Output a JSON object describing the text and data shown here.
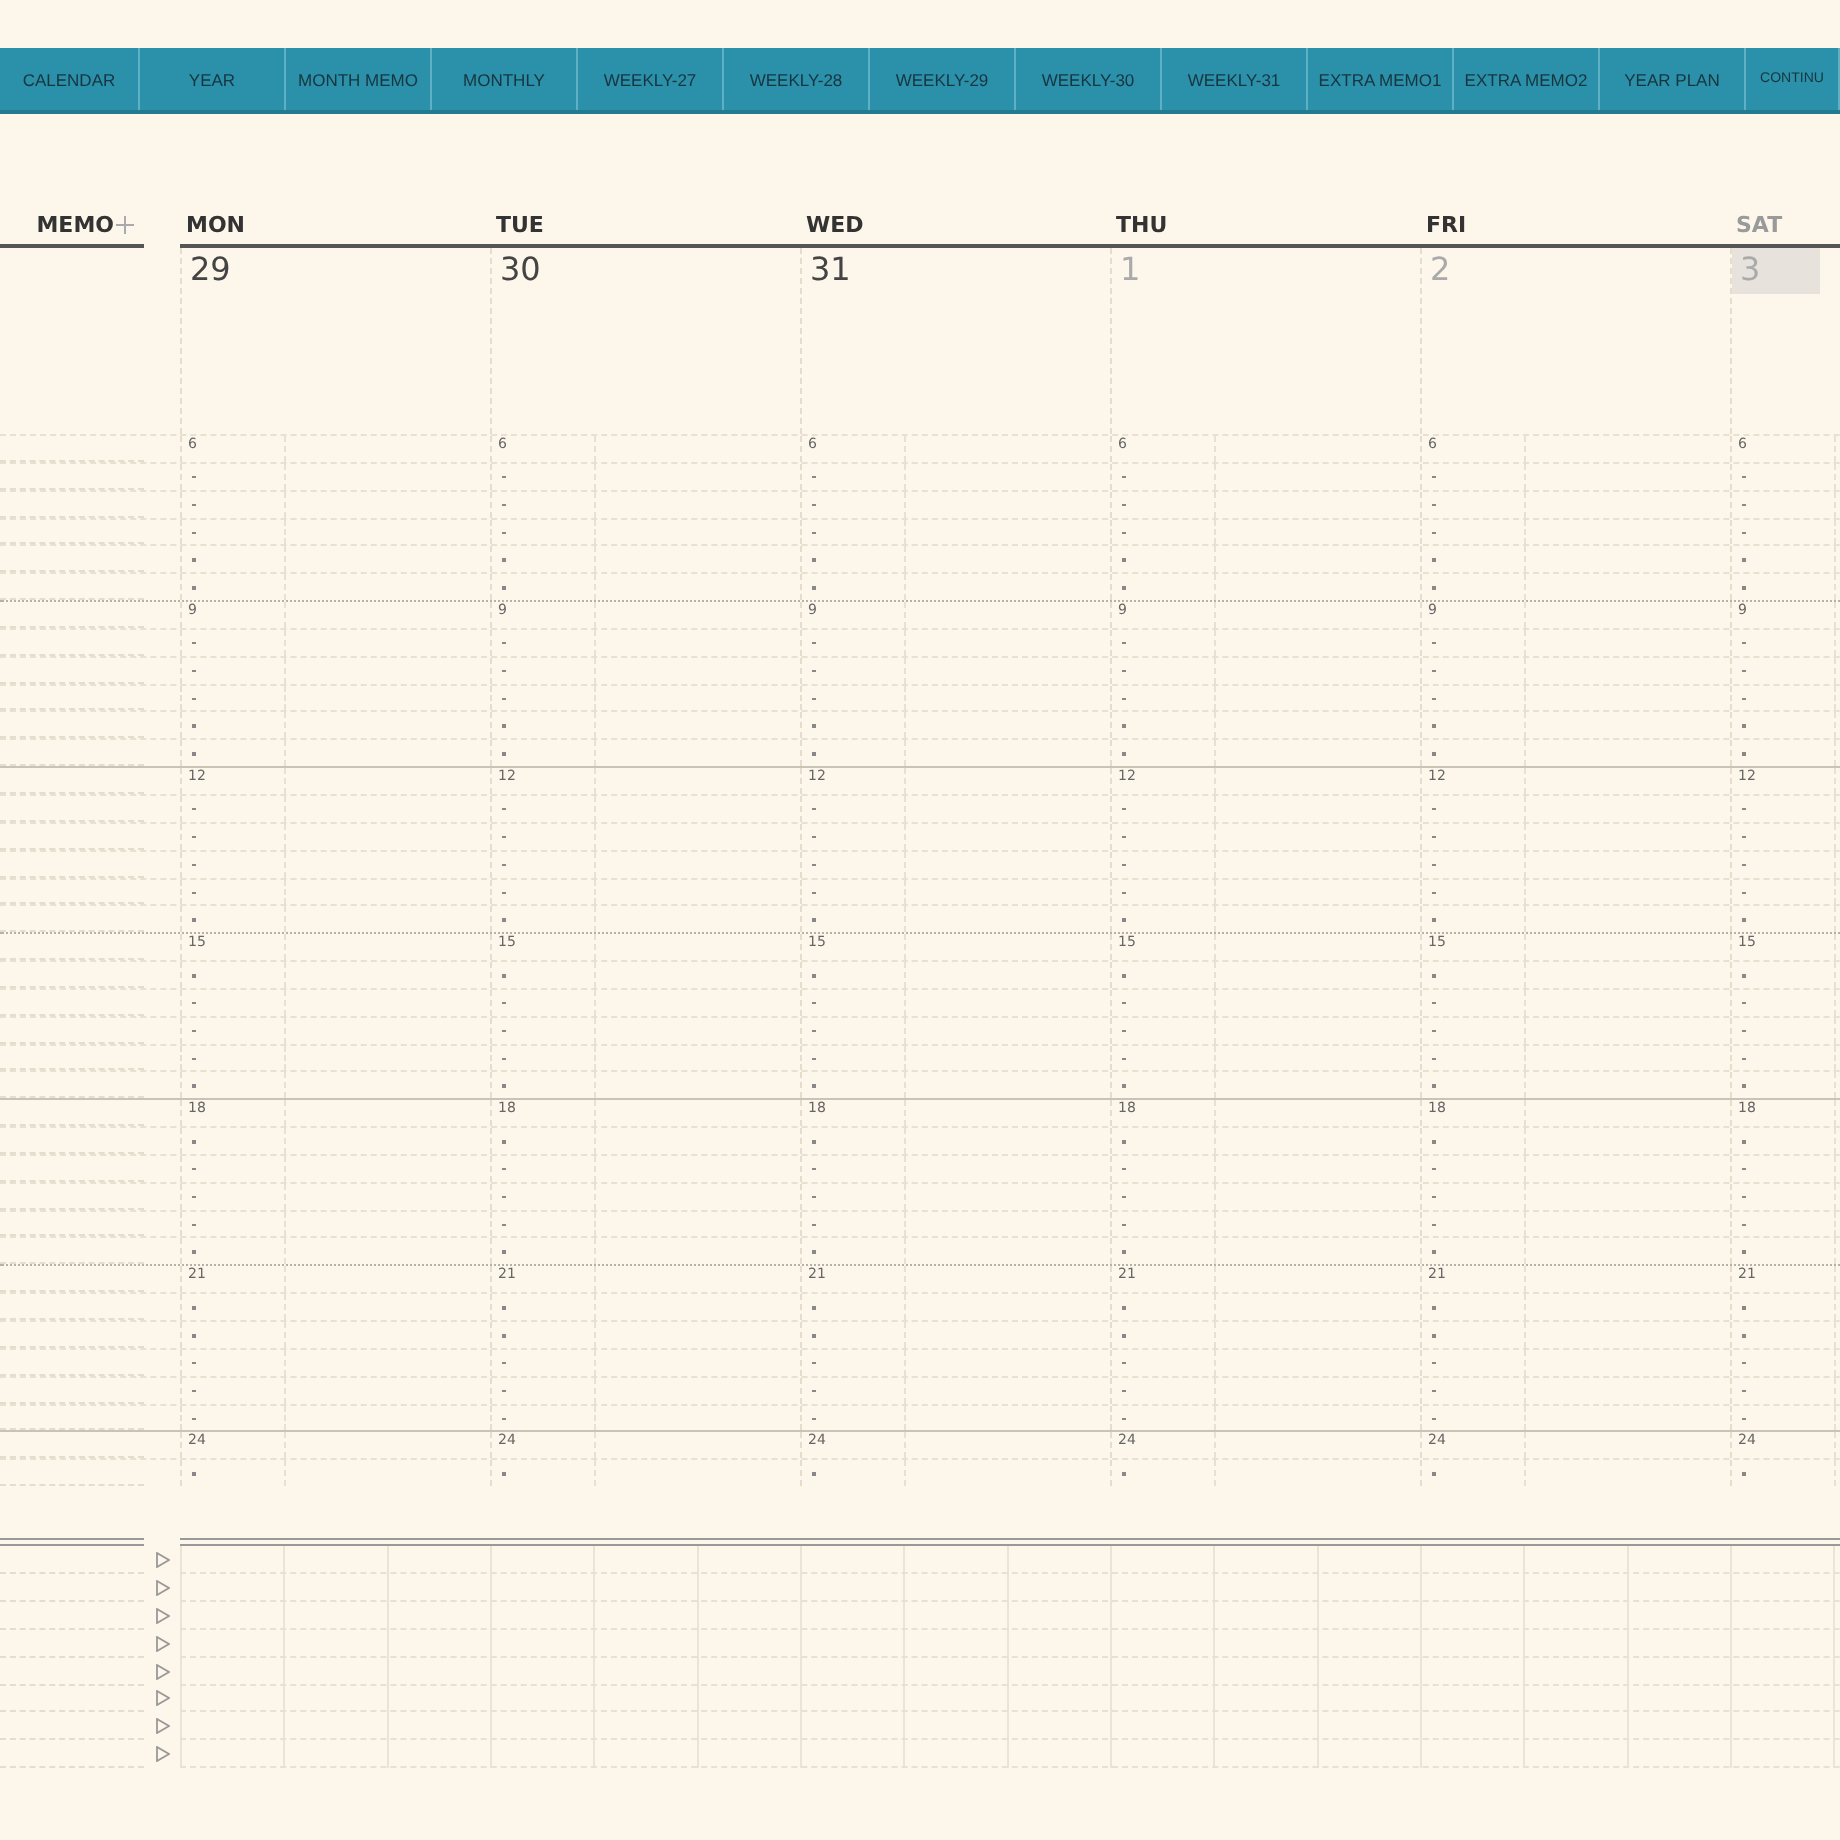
{
  "tabs": [
    {
      "label": "CALENDAR",
      "selected": false
    },
    {
      "label": "YEAR",
      "selected": false
    },
    {
      "label": "MONTH MEMO",
      "selected": false
    },
    {
      "label": "MONTHLY",
      "selected": false
    },
    {
      "label": "WEEKLY-27",
      "selected": false
    },
    {
      "label": "WEEKLY-28",
      "selected": false
    },
    {
      "label": "WEEKLY-29",
      "selected": false
    },
    {
      "label": "WEEKLY-30",
      "selected": false
    },
    {
      "label": "WEEKLY-31",
      "selected": false
    },
    {
      "label": "EXTRA MEMO1",
      "selected": false
    },
    {
      "label": "EXTRA MEMO2",
      "selected": false
    },
    {
      "label": "YEAR PLAN",
      "selected": false
    },
    {
      "label": "CONTINU",
      "selected": false
    }
  ],
  "memo": {
    "label": "MEMO"
  },
  "days": [
    {
      "name": "MON",
      "date": "29",
      "dimmed": false,
      "other_month": false,
      "highlighted": false,
      "hours": [
        "6",
        "9",
        "12",
        "15",
        "18",
        "21",
        "24"
      ]
    },
    {
      "name": "TUE",
      "date": "30",
      "dimmed": false,
      "other_month": false,
      "highlighted": false,
      "hours": [
        "6",
        "9",
        "12",
        "15",
        "18",
        "21",
        "24"
      ]
    },
    {
      "name": "WED",
      "date": "31",
      "dimmed": false,
      "other_month": false,
      "highlighted": false,
      "hours": [
        "6",
        "9",
        "12",
        "15",
        "18",
        "21",
        "24"
      ]
    },
    {
      "name": "THU",
      "date": "1",
      "dimmed": false,
      "other_month": true,
      "highlighted": false,
      "hours": [
        "6",
        "9",
        "12",
        "15",
        "18",
        "21",
        "24"
      ]
    },
    {
      "name": "FRI",
      "date": "2",
      "dimmed": false,
      "other_month": true,
      "highlighted": false,
      "hours": [
        "6",
        "9",
        "12",
        "15",
        "18",
        "21",
        "24"
      ]
    },
    {
      "name": "SAT",
      "date": "3",
      "dimmed": true,
      "other_month": true,
      "highlighted": true,
      "hours": [
        "6",
        "9",
        "12",
        "15",
        "18",
        "21",
        "24"
      ]
    }
  ],
  "notes": [
    {
      "kind": "bullet"
    },
    {
      "kind": "bullet"
    },
    {
      "kind": "bullet"
    },
    {
      "kind": "bullet"
    },
    {
      "kind": "bullet"
    },
    {
      "kind": "bullet"
    },
    {
      "kind": "bullet"
    },
    {
      "kind": "bullet"
    }
  ]
}
